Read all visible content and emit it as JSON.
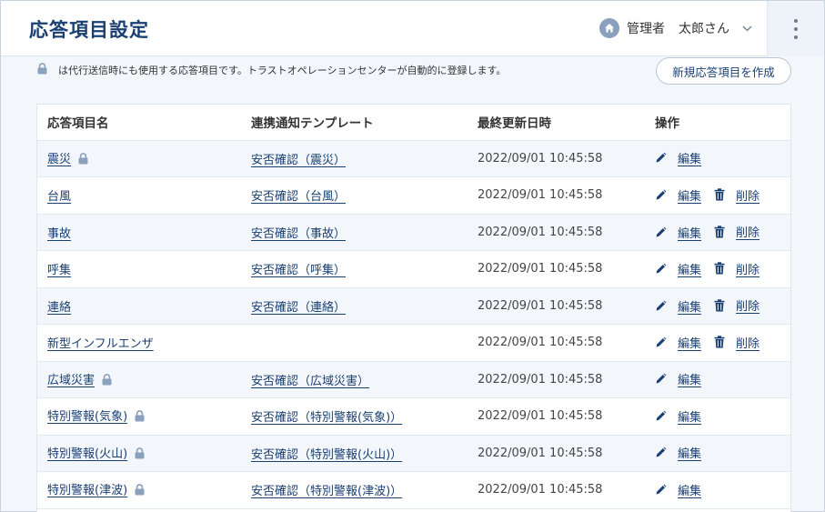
{
  "header": {
    "title": "応答項目設定",
    "role": "管理者",
    "user_name": "太郎さん"
  },
  "notice": {
    "text": "は代行送信時にも使用する応答項目です。トラストオペレーションセンターが自動的に登録します。"
  },
  "create_button_label": "新規応答項目を作成",
  "table": {
    "columns": [
      "応答項目名",
      "連携通知テンプレート",
      "最終更新日時",
      "操作"
    ],
    "edit_label": "編集",
    "delete_label": "削除",
    "rows": [
      {
        "name": "震災",
        "locked": true,
        "template": "安否確認（震災）",
        "updated": "2022/09/01 10:45:58",
        "deletable": false
      },
      {
        "name": "台風",
        "locked": false,
        "template": "安否確認（台風）",
        "updated": "2022/09/01 10:45:58",
        "deletable": true
      },
      {
        "name": "事故",
        "locked": false,
        "template": "安否確認（事故）",
        "updated": "2022/09/01 10:45:58",
        "deletable": true
      },
      {
        "name": "呼集",
        "locked": false,
        "template": "安否確認（呼集）",
        "updated": "2022/09/01 10:45:58",
        "deletable": true
      },
      {
        "name": "連絡",
        "locked": false,
        "template": "安否確認（連絡）",
        "updated": "2022/09/01 10:45:58",
        "deletable": true
      },
      {
        "name": "新型インフルエンザ",
        "locked": false,
        "template": "",
        "updated": "2022/09/01 10:45:58",
        "deletable": true
      },
      {
        "name": "広域災害",
        "locked": true,
        "template": "安否確認（広域災害）",
        "updated": "2022/09/01 10:45:58",
        "deletable": false
      },
      {
        "name": "特別警報(気象)",
        "locked": true,
        "template": "安否確認（特別警報(気象)）",
        "updated": "2022/09/01 10:45:58",
        "deletable": false
      },
      {
        "name": "特別警報(火山)",
        "locked": true,
        "template": "安否確認（特別警報(火山)）",
        "updated": "2022/09/01 10:45:58",
        "deletable": false
      },
      {
        "name": "特別警報(津波)",
        "locked": true,
        "template": "安否確認（特別警報(津波)）",
        "updated": "2022/09/01 10:45:58",
        "deletable": false
      }
    ]
  },
  "icons": {
    "home": "home-icon",
    "chevron": "chevron-down-icon",
    "menu": "kebab-menu-icon",
    "lock": "lock-icon",
    "edit": "pencil-icon",
    "delete": "trash-icon"
  },
  "colors": {
    "accent": "#1a3f73",
    "background": "#f3f7fc",
    "icon_gray": "#8aa0bd"
  }
}
